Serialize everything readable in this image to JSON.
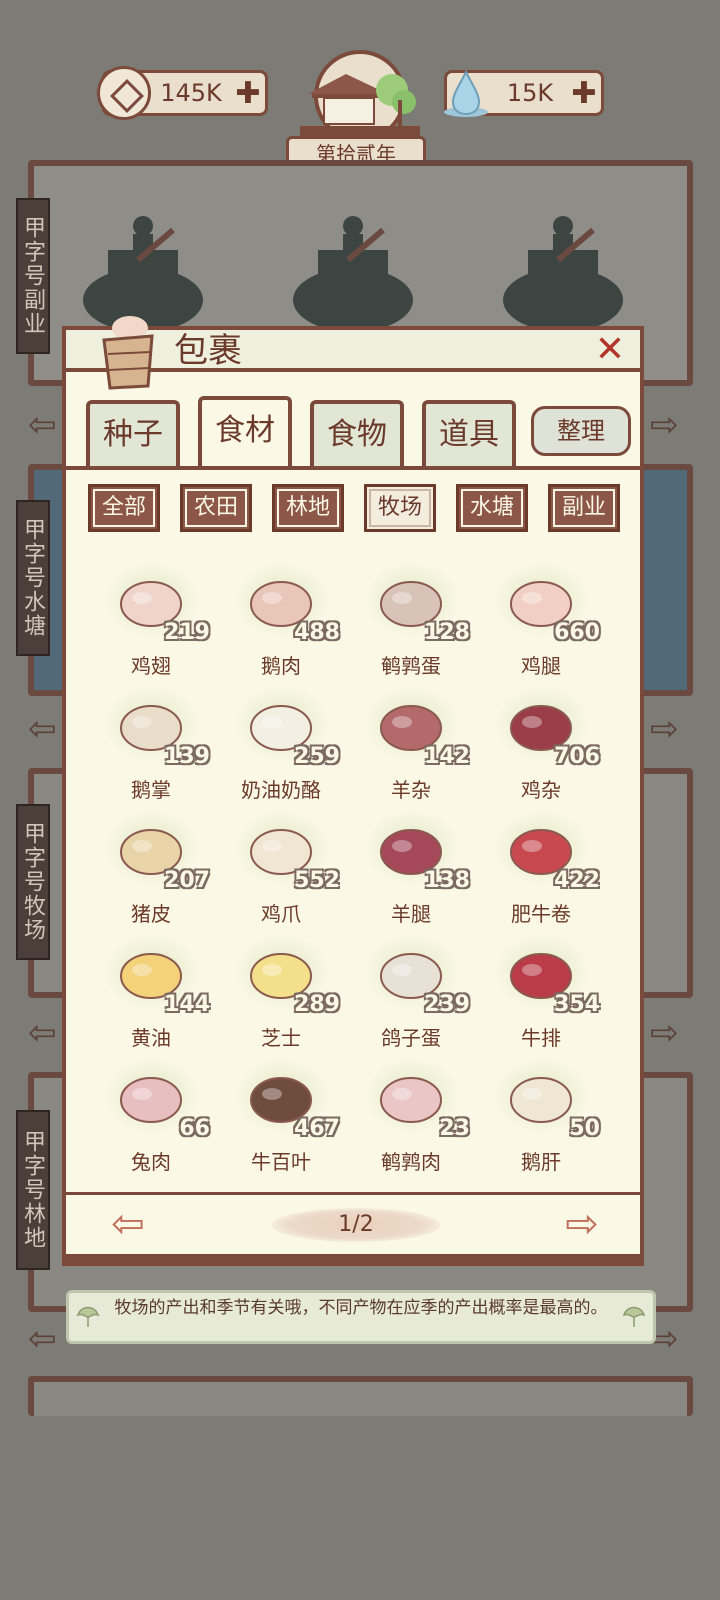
{
  "resources": {
    "coins": "145K",
    "water": "15K",
    "year": "第拾贰年"
  },
  "stations": [
    {
      "label": "甲字号副业"
    },
    {
      "label": "甲字号水塘"
    },
    {
      "label": "甲字号牧场"
    },
    {
      "label": "甲字号林地"
    }
  ],
  "bag": {
    "title": "包裹",
    "close_label": "✕",
    "tabs": [
      "种子",
      "食材",
      "食物",
      "道具"
    ],
    "active_tab": "食材",
    "sort_label": "整理",
    "filters": [
      "全部",
      "农田",
      "林地",
      "牧场",
      "水塘",
      "副业"
    ],
    "active_filter": "牧场",
    "items": [
      {
        "name": "鸡翅",
        "count": "219",
        "icon": "chicken-wing-icon"
      },
      {
        "name": "鹅肉",
        "count": "488",
        "icon": "goose-meat-icon"
      },
      {
        "name": "鹌鹑蛋",
        "count": "128",
        "icon": "quail-egg-icon"
      },
      {
        "name": "鸡腿",
        "count": "660",
        "icon": "chicken-leg-icon"
      },
      {
        "name": "鹅掌",
        "count": "139",
        "icon": "goose-feet-icon"
      },
      {
        "name": "奶油奶酪",
        "count": "259",
        "icon": "cream-cheese-icon"
      },
      {
        "name": "羊杂",
        "count": "142",
        "icon": "lamb-offal-icon"
      },
      {
        "name": "鸡杂",
        "count": "706",
        "icon": "chicken-offal-icon"
      },
      {
        "name": "猪皮",
        "count": "207",
        "icon": "pork-skin-icon"
      },
      {
        "name": "鸡爪",
        "count": "552",
        "icon": "chicken-feet-icon"
      },
      {
        "name": "羊腿",
        "count": "138",
        "icon": "lamb-leg-icon"
      },
      {
        "name": "肥牛卷",
        "count": "422",
        "icon": "beef-roll-icon"
      },
      {
        "name": "黄油",
        "count": "144",
        "icon": "butter-icon"
      },
      {
        "name": "芝士",
        "count": "289",
        "icon": "cheese-icon"
      },
      {
        "name": "鸽子蛋",
        "count": "239",
        "icon": "pigeon-egg-icon"
      },
      {
        "name": "牛排",
        "count": "354",
        "icon": "steak-icon"
      },
      {
        "name": "兔肉",
        "count": "66",
        "icon": "rabbit-meat-icon"
      },
      {
        "name": "牛百叶",
        "count": "467",
        "icon": "beef-tripe-icon"
      },
      {
        "name": "鹌鹑肉",
        "count": "23",
        "icon": "quail-meat-icon"
      },
      {
        "name": "鹅肝",
        "count": "50",
        "icon": "foie-gras-icon"
      }
    ],
    "page": "1/2"
  },
  "tip": "牧场的产出和季节有关哦，不同产物在应季的产出概率是最高的。",
  "colors": {
    "frame": "#7b4a3a",
    "panel": "#fbf8e6",
    "background": "#7d7b76",
    "filter_bg": "#8c5648"
  }
}
